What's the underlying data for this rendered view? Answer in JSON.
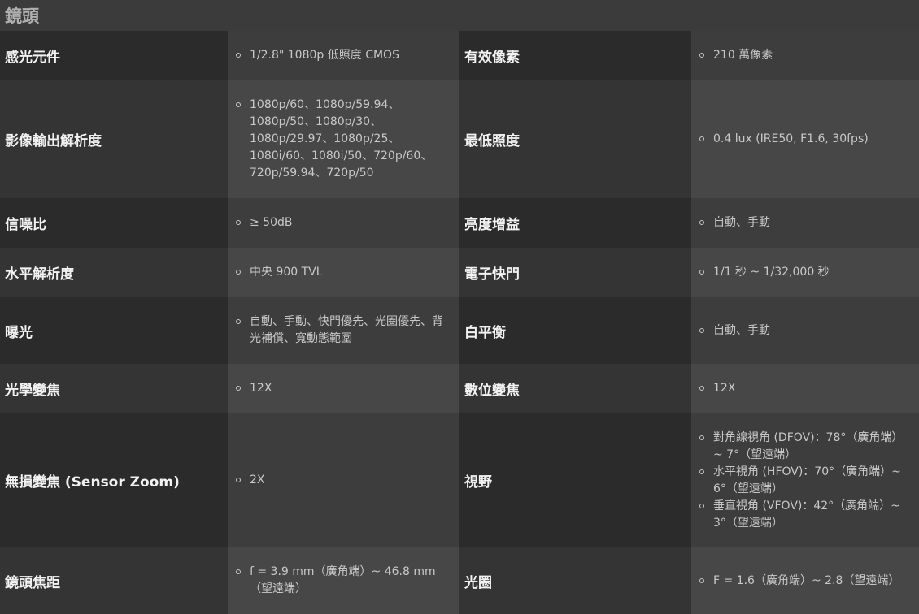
{
  "section_title": "鏡頭",
  "rows": [
    {
      "label1": "感光元件",
      "value1": [
        "1/2.8\" 1080p 低照度 CMOS"
      ],
      "label2": "有效像素",
      "value2": [
        "210 萬像素"
      ]
    },
    {
      "label1": "影像輸出解析度",
      "value1": [
        "1080p/60、1080p/59.94、1080p/50、1080p/30、1080p/29.97、1080p/25、1080i/60、1080i/50、720p/60、720p/59.94、720p/50"
      ],
      "label2": "最低照度",
      "value2": [
        "0.4 lux (IRE50, F1.6, 30fps)"
      ]
    },
    {
      "label1": "信噪比",
      "value1": [
        "≥ 50dB"
      ],
      "label2": "亮度增益",
      "value2": [
        "自動、手動"
      ]
    },
    {
      "label1": "水平解析度",
      "value1": [
        "中央 900 TVL"
      ],
      "label2": "電子快門",
      "value2": [
        "1/1 秒 ~ 1/32,000 秒"
      ]
    },
    {
      "label1": "曝光",
      "value1": [
        "自動、手動、快門優先、光圈優先、背光補償、寬動態範圍"
      ],
      "label2": "白平衡",
      "value2": [
        "自動、手動"
      ]
    },
    {
      "label1": "光學變焦",
      "value1": [
        "12X"
      ],
      "label2": "數位變焦",
      "value2": [
        "12X"
      ]
    },
    {
      "label1": "無損變焦 (Sensor Zoom)",
      "value1": [
        "2X"
      ],
      "label2": "視野",
      "value2": [
        "對角線視角 (DFOV)：78°（廣角端）~ 7°（望遠端）",
        "水平視角 (HFOV)：70°（廣角端）~ 6°（望遠端）",
        "垂直視角 (VFOV)：42°（廣角端）~ 3°（望遠端）"
      ]
    },
    {
      "label1": "鏡頭焦距",
      "value1": [
        "f = 3.9 mm（廣角端）~ 46.8 mm（望遠端）"
      ],
      "label2": "光圈",
      "value2": [
        "F = 1.6（廣角端）~ 2.8（望遠端）"
      ]
    }
  ]
}
